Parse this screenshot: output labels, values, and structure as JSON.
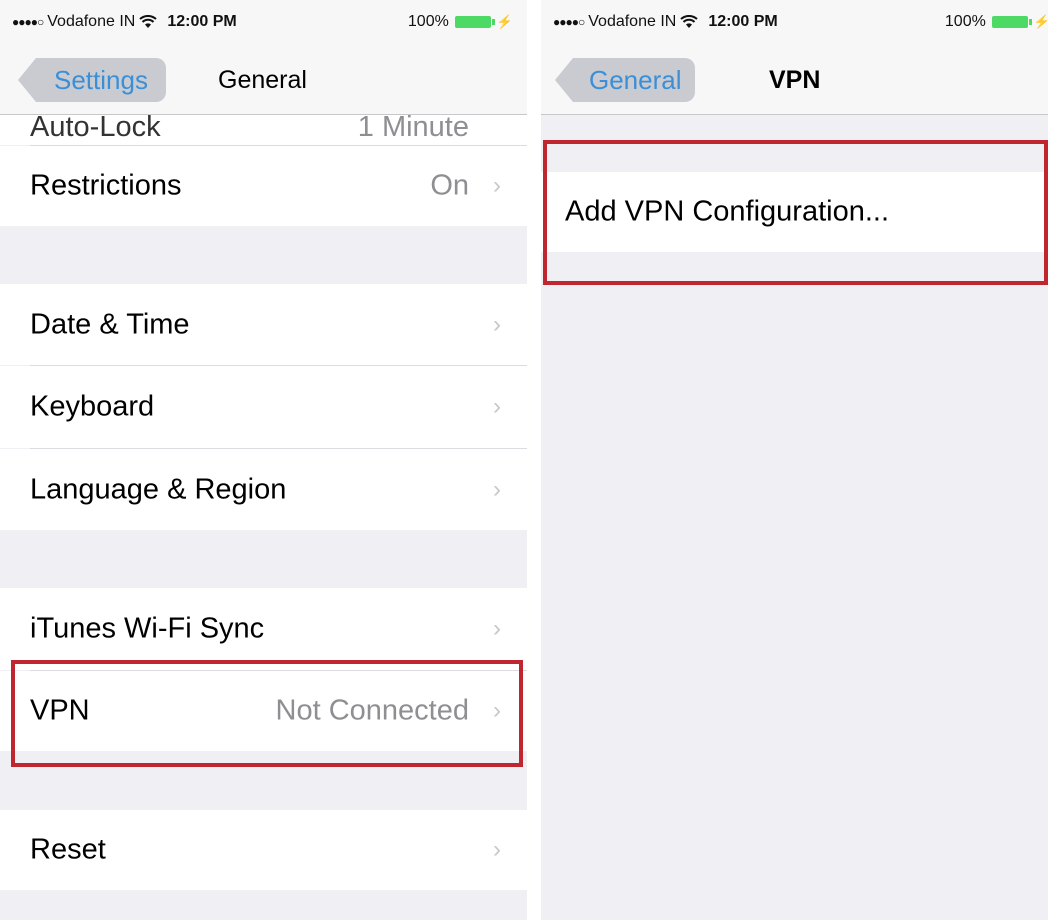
{
  "left": {
    "status": {
      "carrier": "Vodafone IN",
      "time": "12:00 PM",
      "battery": "100%"
    },
    "nav": {
      "back": "Settings",
      "title": "General"
    },
    "rows": [
      {
        "label": "Auto-Lock",
        "value": "1 Minute"
      },
      {
        "label": "Restrictions",
        "value": "On"
      },
      {
        "label": "Date & Time",
        "value": ""
      },
      {
        "label": "Keyboard",
        "value": ""
      },
      {
        "label": "Language & Region",
        "value": ""
      },
      {
        "label": "iTunes Wi-Fi Sync",
        "value": ""
      },
      {
        "label": "VPN",
        "value": "Not Connected"
      },
      {
        "label": "Reset",
        "value": ""
      }
    ]
  },
  "right": {
    "status": {
      "carrier": "Vodafone IN",
      "time": "12:00 PM",
      "battery": "100%"
    },
    "nav": {
      "back": "General",
      "title": "VPN"
    },
    "add_vpn": "Add VPN Configuration..."
  },
  "colors": {
    "highlight": "#c0262f",
    "link": "#2c7fc9",
    "battery": "#4cd964"
  }
}
